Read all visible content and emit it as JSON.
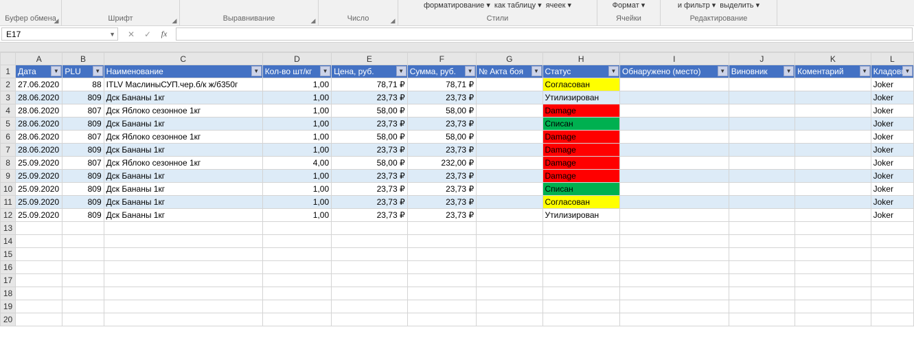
{
  "ribbon": {
    "top_items": {
      "fmt_cond": "форматирование ▾",
      "fmt_table": "как таблицу ▾",
      "cell_styles": "ячеек ▾",
      "format": "Формат ▾",
      "sort_filter": "и фильтр ▾",
      "select": "выделить ▾"
    },
    "groups": {
      "clipboard": "Буфер обмена",
      "font": "Шрифт",
      "alignment": "Выравнивание",
      "number": "Число",
      "styles": "Стили",
      "cells": "Ячейки",
      "editing": "Редактирование"
    }
  },
  "namebox": "E17",
  "headers": {
    "A": "Дата",
    "B": "PLU",
    "C": "Наименование",
    "D": "Кол-во шт/кг",
    "E": "Цена, руб.",
    "F": "Сумма, руб.",
    "G": "№ Акта боя",
    "H": "Статус",
    "I": "Обнаружено (место)",
    "J": "Виновник",
    "K": "Коментарий",
    "L": "Кладовщ"
  },
  "col_letters": [
    "A",
    "B",
    "C",
    "D",
    "E",
    "F",
    "G",
    "H",
    "I",
    "J",
    "K",
    "L"
  ],
  "rows": [
    {
      "n": 2,
      "band": false,
      "A": "27.06.2020",
      "B": "88",
      "C": "ITLV МаслиныСУП.чер.б/к ж/б350г",
      "D": "1,00",
      "E": "78,71 ₽",
      "F": "78,71 ₽",
      "G": "",
      "H": "Согласован",
      "Hc": "st-yellow",
      "I": "",
      "J": "",
      "K": "",
      "L": "Joker"
    },
    {
      "n": 3,
      "band": true,
      "A": "28.06.2020",
      "B": "809",
      "C": "Дск Бананы 1кг",
      "D": "1,00",
      "E": "23,73 ₽",
      "F": "23,73 ₽",
      "G": "",
      "H": "Утилизирован",
      "Hc": "",
      "I": "",
      "J": "",
      "K": "",
      "L": "Joker"
    },
    {
      "n": 4,
      "band": false,
      "A": "28.06.2020",
      "B": "807",
      "C": "Дск Яблоко сезонное 1кг",
      "D": "1,00",
      "E": "58,00 ₽",
      "F": "58,00 ₽",
      "G": "",
      "H": "Damage",
      "Hc": "st-red",
      "I": "",
      "J": "",
      "K": "",
      "L": "Joker"
    },
    {
      "n": 5,
      "band": true,
      "A": "28.06.2020",
      "B": "809",
      "C": "Дск Бананы 1кг",
      "D": "1,00",
      "E": "23,73 ₽",
      "F": "23,73 ₽",
      "G": "",
      "H": "Списан",
      "Hc": "st-green",
      "I": "",
      "J": "",
      "K": "",
      "L": "Joker"
    },
    {
      "n": 6,
      "band": false,
      "A": "28.06.2020",
      "B": "807",
      "C": "Дск Яблоко сезонное 1кг",
      "D": "1,00",
      "E": "58,00 ₽",
      "F": "58,00 ₽",
      "G": "",
      "H": "Damage",
      "Hc": "st-red",
      "I": "",
      "J": "",
      "K": "",
      "L": "Joker"
    },
    {
      "n": 7,
      "band": true,
      "A": "28.06.2020",
      "B": "809",
      "C": "Дск Бананы 1кг",
      "D": "1,00",
      "E": "23,73 ₽",
      "F": "23,73 ₽",
      "G": "",
      "H": "Damage",
      "Hc": "st-red",
      "I": "",
      "J": "",
      "K": "",
      "L": "Joker"
    },
    {
      "n": 8,
      "band": false,
      "A": "25.09.2020",
      "B": "807",
      "C": "Дск Яблоко сезонное 1кг",
      "D": "4,00",
      "E": "58,00 ₽",
      "F": "232,00 ₽",
      "G": "",
      "H": "Damage",
      "Hc": "st-red",
      "I": "",
      "J": "",
      "K": "",
      "L": "Joker"
    },
    {
      "n": 9,
      "band": true,
      "A": "25.09.2020",
      "B": "809",
      "C": "Дск Бананы 1кг",
      "D": "1,00",
      "E": "23,73 ₽",
      "F": "23,73 ₽",
      "G": "",
      "H": "Damage",
      "Hc": "st-red",
      "I": "",
      "J": "",
      "K": "",
      "L": "Joker"
    },
    {
      "n": 10,
      "band": false,
      "A": "25.09.2020",
      "B": "809",
      "C": "Дск Бананы 1кг",
      "D": "1,00",
      "E": "23,73 ₽",
      "F": "23,73 ₽",
      "G": "",
      "H": "Списан",
      "Hc": "st-green",
      "I": "",
      "J": "",
      "K": "",
      "L": "Joker"
    },
    {
      "n": 11,
      "band": true,
      "A": "25.09.2020",
      "B": "809",
      "C": "Дск Бананы 1кг",
      "D": "1,00",
      "E": "23,73 ₽",
      "F": "23,73 ₽",
      "G": "",
      "H": "Согласован",
      "Hc": "st-yellow",
      "I": "",
      "J": "",
      "K": "",
      "L": "Joker"
    },
    {
      "n": 12,
      "band": false,
      "A": "25.09.2020",
      "B": "809",
      "C": "Дск Бананы 1кг",
      "D": "1,00",
      "E": "23,73 ₽",
      "F": "23,73 ₽",
      "G": "",
      "H": "Утилизирован",
      "Hc": "",
      "I": "",
      "J": "",
      "K": "",
      "L": "Joker"
    }
  ],
  "empty_rows": [
    13,
    14,
    15,
    16,
    17,
    18,
    19,
    20
  ]
}
